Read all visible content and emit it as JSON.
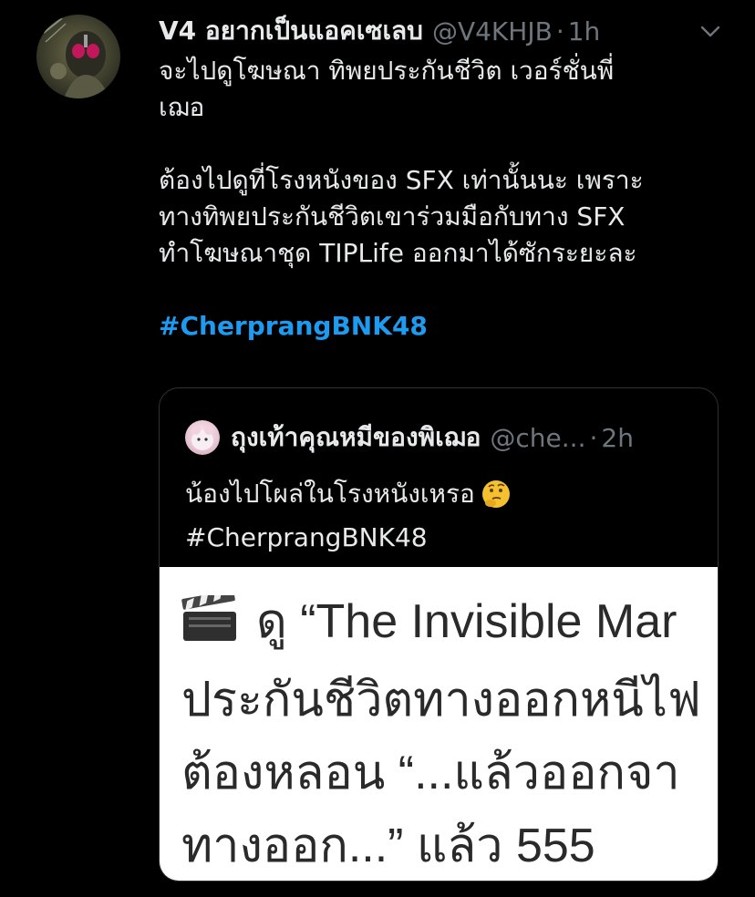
{
  "tweet": {
    "display_name": "V4 อยากเป็นแอคเซเลบ",
    "handle": "@V4KHJB",
    "separator": "·",
    "time": "1h",
    "body_line1": "จะไปดูโฆษณา ทิพยประกันชีวิต เวอร์ชั่นพี่",
    "body_line2": "เฌอ",
    "body_para2_line1": "ต้องไปดูที่โรงหนังของ SFX เท่านั้นนะ เพราะ",
    "body_para2_line2": "ทางทิพยประกันชีวิตเขาร่วมมือกับทาง SFX",
    "body_para2_line3": "ทำโฆษณาชุด TIPLife ออกมาได้ซักระยะละ",
    "hashtag": "#CherprangBNK48",
    "avatar_icon": "masked-rider-avatar",
    "menu_icon": "chevron-down-icon"
  },
  "quote": {
    "display_name": "ถุงเท้าคุณหมีของพิเฌอ",
    "handle": "@che...",
    "separator": "·",
    "time": "2h",
    "body_line1": "น้องไปโผล่ในโรงหนังเหรอ",
    "emoji_icon": "thinking-face-emoji",
    "hashtag": "#CherprangBNK48",
    "avatar_icon": "pink-character-avatar"
  },
  "media": {
    "icon": "clapper-board-emoji",
    "line1": "ดู “The Invisible Mar",
    "line2": "ประกันชีวิตทางออกหนีไฟ",
    "line3": "ต้องหลอน “...แล้วออกจา",
    "line4": "ทางออก...” แล้ว 555"
  },
  "colors": {
    "background": "#000000",
    "text_primary": "#e7e9ea",
    "text_secondary": "#6e767d",
    "link": "#1d9bf0",
    "card_border": "#2f3336"
  }
}
